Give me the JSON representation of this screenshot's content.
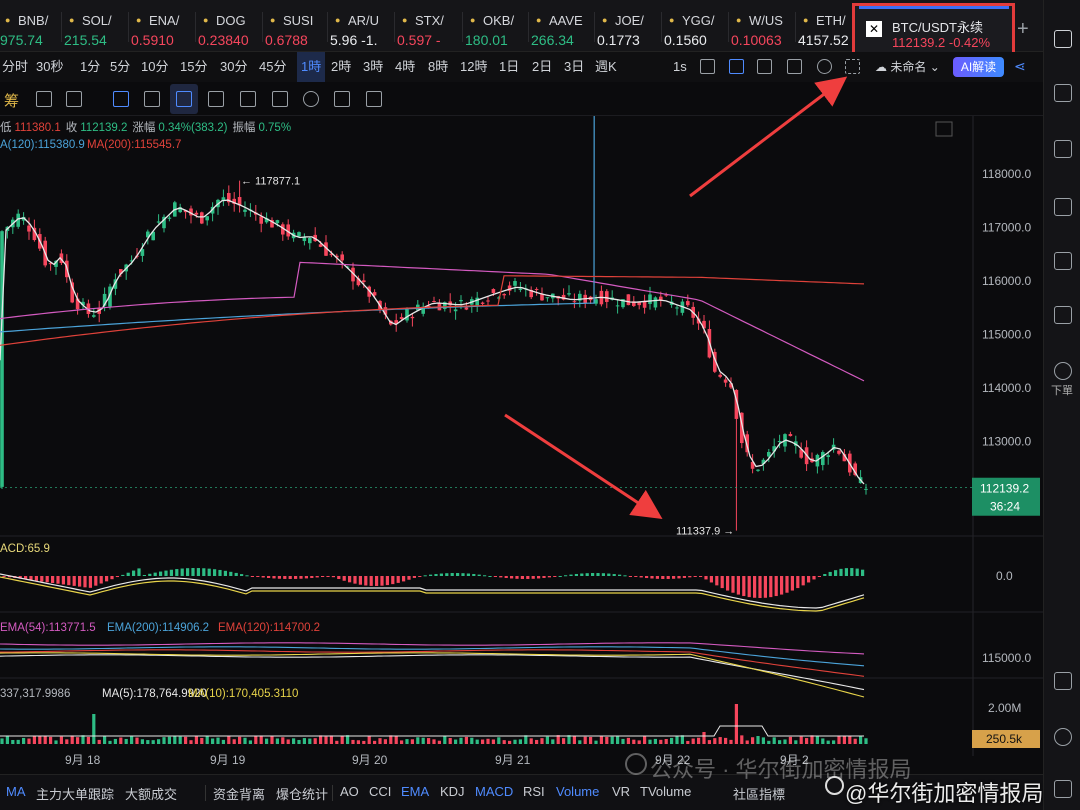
{
  "tickers": [
    {
      "sym": "BNB/",
      "price": "975.74",
      "dir": "up",
      "x": 0
    },
    {
      "sym": "SOL/",
      "price": "215.54",
      "dir": "up",
      "x": 64
    },
    {
      "sym": "ENA/",
      "price": "0.5910",
      "dir": "dn",
      "x": 131
    },
    {
      "sym": "DOG",
      "price": "0.23840",
      "dir": "dn",
      "x": 198
    },
    {
      "sym": "SUSI",
      "price": "0.6788",
      "dir": "dn",
      "x": 265
    },
    {
      "sym": "AR/U",
      "price": "5.96 -1.",
      "dir": "wt",
      "x": 330
    },
    {
      "sym": "STX/",
      "price": "0.597 -",
      "dir": "dn",
      "x": 397
    },
    {
      "sym": "OKB/",
      "price": "180.01",
      "dir": "up",
      "x": 465
    },
    {
      "sym": "AAVE",
      "price": "266.34",
      "dir": "up",
      "x": 531
    },
    {
      "sym": "JOE/",
      "price": "0.1773",
      "dir": "wt",
      "x": 597
    },
    {
      "sym": "YGG/",
      "price": "0.1560",
      "dir": "wt",
      "x": 664
    },
    {
      "sym": "W/US",
      "price": "0.10063",
      "dir": "dn",
      "x": 731
    },
    {
      "sym": "ETH/",
      "price": "4157.52",
      "dir": "wt",
      "x": 798
    }
  ],
  "active_ticker": {
    "sym": "BTC/USDT永续",
    "price": "112139.2 -0.42%"
  },
  "timeframes": [
    "分时",
    "30秒",
    "1分",
    "5分",
    "10分",
    "15分",
    "30分",
    "45分",
    "1時",
    "2時",
    "3時",
    "4時",
    "8時",
    "12時",
    "1日",
    "2日",
    "3日",
    "週K",
    "1s"
  ],
  "selected_timeframe": "1時",
  "layout_name": "未命名",
  "ai_button": "AI解读",
  "tool_label": "筹",
  "rail_label": "下單",
  "ohlc": {
    "low_label": "低",
    "low": "111380.1",
    "close_label": "收",
    "close": "112139.2",
    "change_label": "涨幅",
    "change": "0.34%(383.2)",
    "amp_label": "振幅",
    "amp": "0.75%"
  },
  "ma_labels": [
    "A(120):115380.9",
    "MA(200):115545.7"
  ],
  "macd_label": "ACD:65.9",
  "ema_labels": [
    "EMA(54):113771.5",
    "EMA(200):114906.2",
    "EMA(120):114700.2"
  ],
  "vol_labels": [
    "337,317.9986",
    "MA(5):178,764.9920",
    "MA(10):170,405.3110"
  ],
  "annotations": {
    "high": "← 117877.1",
    "low": "111337.9 →"
  },
  "price_ticks": [
    "118000.0",
    "117000.0",
    "116000.0",
    "115000.0",
    "114000.0",
    "113000.0"
  ],
  "current_price": "112139.2",
  "countdown": "36:24",
  "macd_tick": "0.0",
  "ema_tick": "115000.0",
  "vol_tick": "2.00M",
  "vol_current": "250.5k",
  "dates": [
    "9月 18",
    "9月 19",
    "9月 20",
    "9月 21",
    "9月 22",
    "9月 2"
  ],
  "bottom_items": [
    {
      "t": "MA",
      "b": true
    },
    {
      "t": "主力大单跟踪"
    },
    {
      "t": "大额成交"
    },
    {
      "t": "资金背离"
    },
    {
      "t": "爆仓统计"
    },
    {
      "t": "AO"
    },
    {
      "t": "CCI"
    },
    {
      "t": "EMA",
      "b": true
    },
    {
      "t": "KDJ"
    },
    {
      "t": "MACD",
      "b": true
    },
    {
      "t": "RSI"
    },
    {
      "t": "Volume",
      "b": true
    },
    {
      "t": "VR"
    },
    {
      "t": "TVolume"
    },
    {
      "t": "社區指標"
    }
  ],
  "watermark_1": "公众号 · 华尔街加密情报局",
  "watermark_2": "@华尔街加密情报局",
  "colors": {
    "up": "#2ebd85",
    "down": "#f6465d",
    "ma_white": "#e8e8e8",
    "ma_pink": "#d45bc1",
    "ma_blue": "#4ba3d9",
    "ma_red": "#e0423a",
    "accent": "#4f8bff"
  },
  "chart_data": {
    "type": "candlestick",
    "y_range": [
      111200,
      118300
    ],
    "price_ticks": [
      118000,
      117000,
      116000,
      115000,
      114000,
      113000
    ],
    "high": 117877.1,
    "low": 111337.9,
    "current": 112139.2,
    "ma120_value": 115380.9,
    "ma200_value": 115545.7,
    "ema54": 113771.5,
    "ema200": 114906.2,
    "ema120": 114700.2,
    "macd": 65.9
  }
}
